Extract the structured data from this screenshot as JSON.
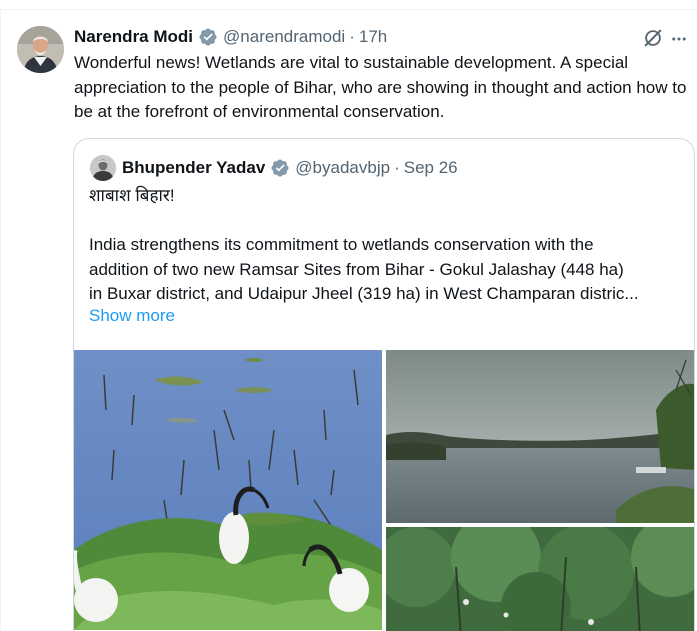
{
  "tweet": {
    "author_name": "Narendra Modi",
    "handle": "@narendramodi",
    "separator": "·",
    "time": "17h",
    "text": "Wonderful news! Wetlands are vital to sustainable development. A special appreciation to the people of Bihar, who are showing in thought and action how to be at the forefront of environmental conservation."
  },
  "quote": {
    "author_name": "Bhupender Yadav",
    "handle": "@byadavbjp",
    "separator": "·",
    "date": "Sep 26",
    "lines": [
      "शाबाश बिहार!",
      "",
      "India strengthens its commitment to wetlands conservation with the",
      "addition of two new Ramsar Sites from Bihar - Gokul Jalashay (448 ha)",
      "in Buxar district, and Udaipur Jheel (319 ha) in West Champaran distric..."
    ],
    "show_more": "Show more"
  },
  "icons": {
    "verified": "verified-badge-icon",
    "grok": "grok-icon",
    "more": "more-icon"
  },
  "colors": {
    "text": "#0f1419",
    "secondary": "#536471",
    "link": "#1d9bf0",
    "border": "#cfd9de"
  }
}
